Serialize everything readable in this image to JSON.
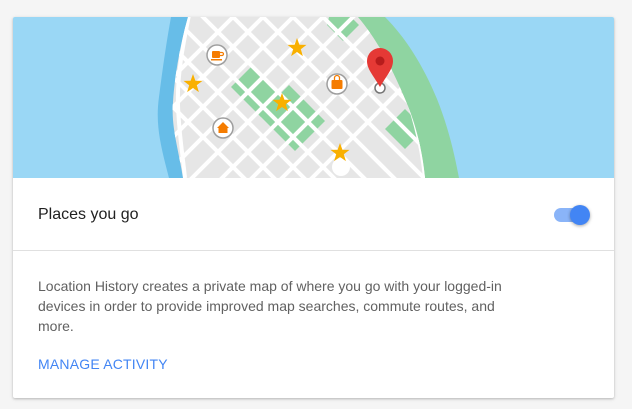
{
  "setting": {
    "label": "Places you go",
    "enabled": true
  },
  "description": "Location History creates a private map of where you go with your logged-in devices in order to provide improved map searches, commute routes, and more.",
  "actions": {
    "manage_label": "MANAGE ACTIVITY"
  },
  "colors": {
    "water": "#9ad7f5",
    "land": "#e6e6e6",
    "park": "#8fd4a1",
    "accent": "#4285f4",
    "pin": "#e53935",
    "star": "#f9b000"
  },
  "map_icons": [
    "coffee-icon",
    "home-icon",
    "shopping-bag-icon",
    "star-icon",
    "location-pin-icon"
  ]
}
